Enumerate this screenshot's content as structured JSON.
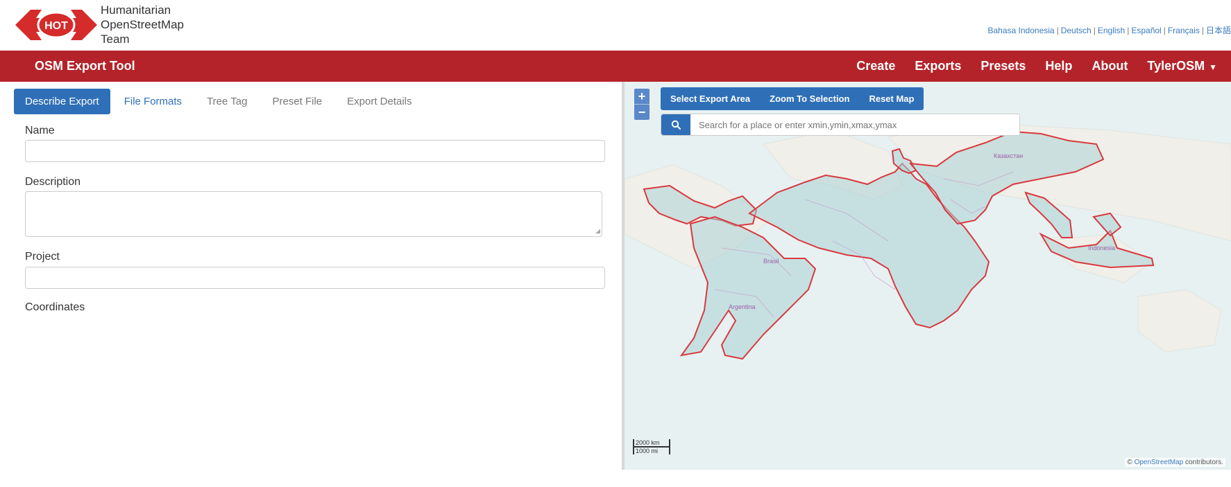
{
  "logo": {
    "badge": "HOT",
    "line1": "Humanitarian",
    "line2": "OpenStreetMap",
    "line3": "Team"
  },
  "languages": [
    "Bahasa Indonesia",
    "Deutsch",
    "English",
    "Español",
    "Français",
    "日本語"
  ],
  "navbar": {
    "brand": "OSM Export Tool",
    "items": [
      "Create",
      "Exports",
      "Presets",
      "Help",
      "About",
      "TylerOSM"
    ]
  },
  "tabs": [
    "Describe Export",
    "File Formats",
    "Tree Tag",
    "Preset File",
    "Export Details"
  ],
  "form": {
    "name_label": "Name",
    "description_label": "Description",
    "project_label": "Project",
    "coordinates_label": "Coordinates"
  },
  "map": {
    "zoom_in": "+",
    "zoom_out": "−",
    "buttons": [
      "Select Export Area",
      "Zoom To Selection",
      "Reset Map"
    ],
    "search_placeholder": "Search for a place or enter xmin,ymin,xmax,ymax",
    "labels": {
      "kazakhstan": "Казахстан",
      "brasil": "Brasil",
      "argentina": "Argentina",
      "indonesia": "Indonesia"
    },
    "scale_km": "2000 km",
    "scale_mi": "1000 mi",
    "attribution_prefix": "©",
    "attribution_link": "OpenStreetMap",
    "attribution_suffix": "contributors."
  },
  "colors": {
    "brand_red": "#b5232a",
    "primary_blue": "#2f6fb7",
    "polygon_red": "#d9383e"
  }
}
